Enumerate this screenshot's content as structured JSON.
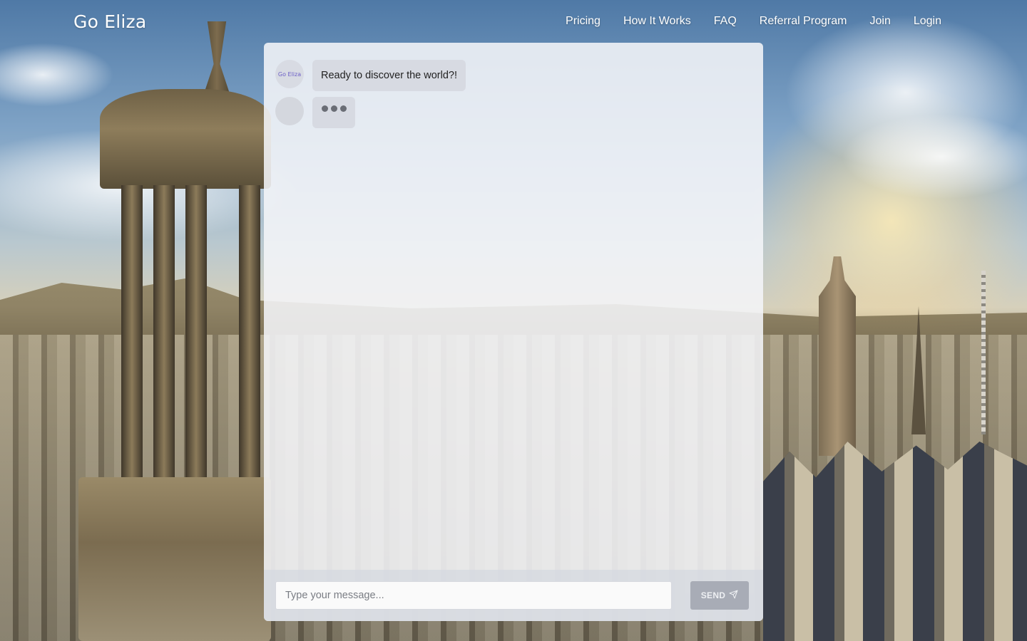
{
  "header": {
    "brand": "Go Eliza",
    "nav": [
      {
        "label": "Pricing"
      },
      {
        "label": "How It Works"
      },
      {
        "label": "FAQ"
      },
      {
        "label": "Referral Program"
      },
      {
        "label": "Join"
      },
      {
        "label": "Login"
      }
    ]
  },
  "chat": {
    "bot_avatar_label": "Go Eliza",
    "messages": [
      {
        "sender": "bot",
        "text": "Ready to discover the world?!"
      }
    ],
    "typing_indicator": true
  },
  "composer": {
    "placeholder": "Type your message...",
    "send_label": "SEND",
    "send_icon": "paper-plane-icon"
  },
  "colors": {
    "panel_bg": "#f4f5f8",
    "bubble_bg": "#d7dae2",
    "send_button_bg": "#a8acb6",
    "avatar_text": "#6c5fc7"
  }
}
